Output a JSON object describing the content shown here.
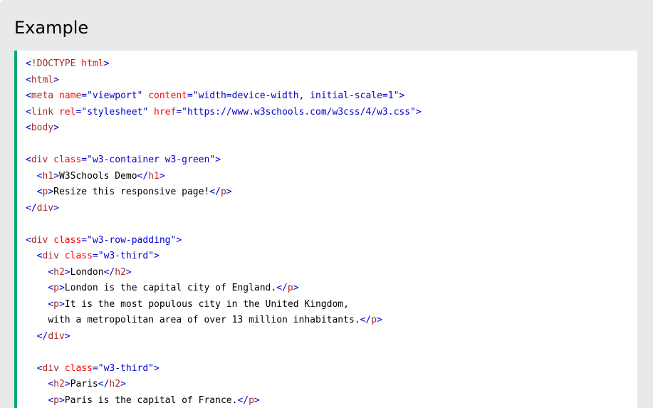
{
  "example": {
    "title": "Example",
    "accent_color": "#04aa6d",
    "background_color": "#e7e9eb",
    "code_lines": [
      [
        {
          "t": "b",
          "v": "<"
        },
        {
          "t": "n",
          "v": "!DOCTYPE"
        },
        {
          "t": "s",
          "v": " "
        },
        {
          "t": "a",
          "v": "html"
        },
        {
          "t": "b",
          "v": ">"
        }
      ],
      [
        {
          "t": "b",
          "v": "<"
        },
        {
          "t": "n",
          "v": "html"
        },
        {
          "t": "b",
          "v": ">"
        }
      ],
      [
        {
          "t": "b",
          "v": "<"
        },
        {
          "t": "n",
          "v": "meta"
        },
        {
          "t": "s",
          "v": " "
        },
        {
          "t": "a",
          "v": "name"
        },
        {
          "t": "v",
          "v": "=\"viewport\""
        },
        {
          "t": "s",
          "v": " "
        },
        {
          "t": "a",
          "v": "content"
        },
        {
          "t": "v",
          "v": "=\"width=device-width, initial-scale=1\""
        },
        {
          "t": "b",
          "v": ">"
        }
      ],
      [
        {
          "t": "b",
          "v": "<"
        },
        {
          "t": "n",
          "v": "link"
        },
        {
          "t": "s",
          "v": " "
        },
        {
          "t": "a",
          "v": "rel"
        },
        {
          "t": "v",
          "v": "=\"stylesheet\""
        },
        {
          "t": "s",
          "v": " "
        },
        {
          "t": "a",
          "v": "href"
        },
        {
          "t": "v",
          "v": "=\"https://www.w3schools.com/w3css/4/w3.css\""
        },
        {
          "t": "b",
          "v": ">"
        }
      ],
      [
        {
          "t": "b",
          "v": "<"
        },
        {
          "t": "n",
          "v": "body"
        },
        {
          "t": "b",
          "v": ">"
        }
      ],
      [],
      [
        {
          "t": "b",
          "v": "<"
        },
        {
          "t": "n",
          "v": "div"
        },
        {
          "t": "s",
          "v": " "
        },
        {
          "t": "a",
          "v": "class"
        },
        {
          "t": "v",
          "v": "=\"w3-container w3-green\""
        },
        {
          "t": "b",
          "v": ">"
        }
      ],
      [
        {
          "t": "s",
          "v": "  "
        },
        {
          "t": "b",
          "v": "<"
        },
        {
          "t": "n",
          "v": "h1"
        },
        {
          "t": "b",
          "v": ">"
        },
        {
          "t": "x",
          "v": "W3Schools Demo"
        },
        {
          "t": "b",
          "v": "</"
        },
        {
          "t": "n",
          "v": "h1"
        },
        {
          "t": "b",
          "v": ">"
        }
      ],
      [
        {
          "t": "s",
          "v": "  "
        },
        {
          "t": "b",
          "v": "<"
        },
        {
          "t": "n",
          "v": "p"
        },
        {
          "t": "b",
          "v": ">"
        },
        {
          "t": "x",
          "v": "Resize this responsive page!"
        },
        {
          "t": "b",
          "v": "</"
        },
        {
          "t": "n",
          "v": "p"
        },
        {
          "t": "b",
          "v": ">"
        }
      ],
      [
        {
          "t": "b",
          "v": "</"
        },
        {
          "t": "n",
          "v": "div"
        },
        {
          "t": "b",
          "v": ">"
        }
      ],
      [],
      [
        {
          "t": "b",
          "v": "<"
        },
        {
          "t": "n",
          "v": "div"
        },
        {
          "t": "s",
          "v": " "
        },
        {
          "t": "a",
          "v": "class"
        },
        {
          "t": "v",
          "v": "=\"w3-row-padding\""
        },
        {
          "t": "b",
          "v": ">"
        }
      ],
      [
        {
          "t": "s",
          "v": "  "
        },
        {
          "t": "b",
          "v": "<"
        },
        {
          "t": "n",
          "v": "div"
        },
        {
          "t": "s",
          "v": " "
        },
        {
          "t": "a",
          "v": "class"
        },
        {
          "t": "v",
          "v": "=\"w3-third\""
        },
        {
          "t": "b",
          "v": ">"
        }
      ],
      [
        {
          "t": "s",
          "v": "    "
        },
        {
          "t": "b",
          "v": "<"
        },
        {
          "t": "n",
          "v": "h2"
        },
        {
          "t": "b",
          "v": ">"
        },
        {
          "t": "x",
          "v": "London"
        },
        {
          "t": "b",
          "v": "</"
        },
        {
          "t": "n",
          "v": "h2"
        },
        {
          "t": "b",
          "v": ">"
        }
      ],
      [
        {
          "t": "s",
          "v": "    "
        },
        {
          "t": "b",
          "v": "<"
        },
        {
          "t": "n",
          "v": "p"
        },
        {
          "t": "b",
          "v": ">"
        },
        {
          "t": "x",
          "v": "London is the capital city of England."
        },
        {
          "t": "b",
          "v": "</"
        },
        {
          "t": "n",
          "v": "p"
        },
        {
          "t": "b",
          "v": ">"
        }
      ],
      [
        {
          "t": "s",
          "v": "    "
        },
        {
          "t": "b",
          "v": "<"
        },
        {
          "t": "n",
          "v": "p"
        },
        {
          "t": "b",
          "v": ">"
        },
        {
          "t": "x",
          "v": "It is the most populous city in the United Kingdom,"
        }
      ],
      [
        {
          "t": "s",
          "v": "    "
        },
        {
          "t": "x",
          "v": "with a metropolitan area of over 13 million inhabitants."
        },
        {
          "t": "b",
          "v": "</"
        },
        {
          "t": "n",
          "v": "p"
        },
        {
          "t": "b",
          "v": ">"
        }
      ],
      [
        {
          "t": "s",
          "v": "  "
        },
        {
          "t": "b",
          "v": "</"
        },
        {
          "t": "n",
          "v": "div"
        },
        {
          "t": "b",
          "v": ">"
        }
      ],
      [],
      [
        {
          "t": "s",
          "v": "  "
        },
        {
          "t": "b",
          "v": "<"
        },
        {
          "t": "n",
          "v": "div"
        },
        {
          "t": "s",
          "v": " "
        },
        {
          "t": "a",
          "v": "class"
        },
        {
          "t": "v",
          "v": "=\"w3-third\""
        },
        {
          "t": "b",
          "v": ">"
        }
      ],
      [
        {
          "t": "s",
          "v": "    "
        },
        {
          "t": "b",
          "v": "<"
        },
        {
          "t": "n",
          "v": "h2"
        },
        {
          "t": "b",
          "v": ">"
        },
        {
          "t": "x",
          "v": "Paris"
        },
        {
          "t": "b",
          "v": "</"
        },
        {
          "t": "n",
          "v": "h2"
        },
        {
          "t": "b",
          "v": ">"
        }
      ],
      [
        {
          "t": "s",
          "v": "    "
        },
        {
          "t": "b",
          "v": "<"
        },
        {
          "t": "n",
          "v": "p"
        },
        {
          "t": "b",
          "v": ">"
        },
        {
          "t": "x",
          "v": "Paris is the capital of France."
        },
        {
          "t": "b",
          "v": "</"
        },
        {
          "t": "n",
          "v": "p"
        },
        {
          "t": "b",
          "v": ">"
        }
      ]
    ]
  }
}
